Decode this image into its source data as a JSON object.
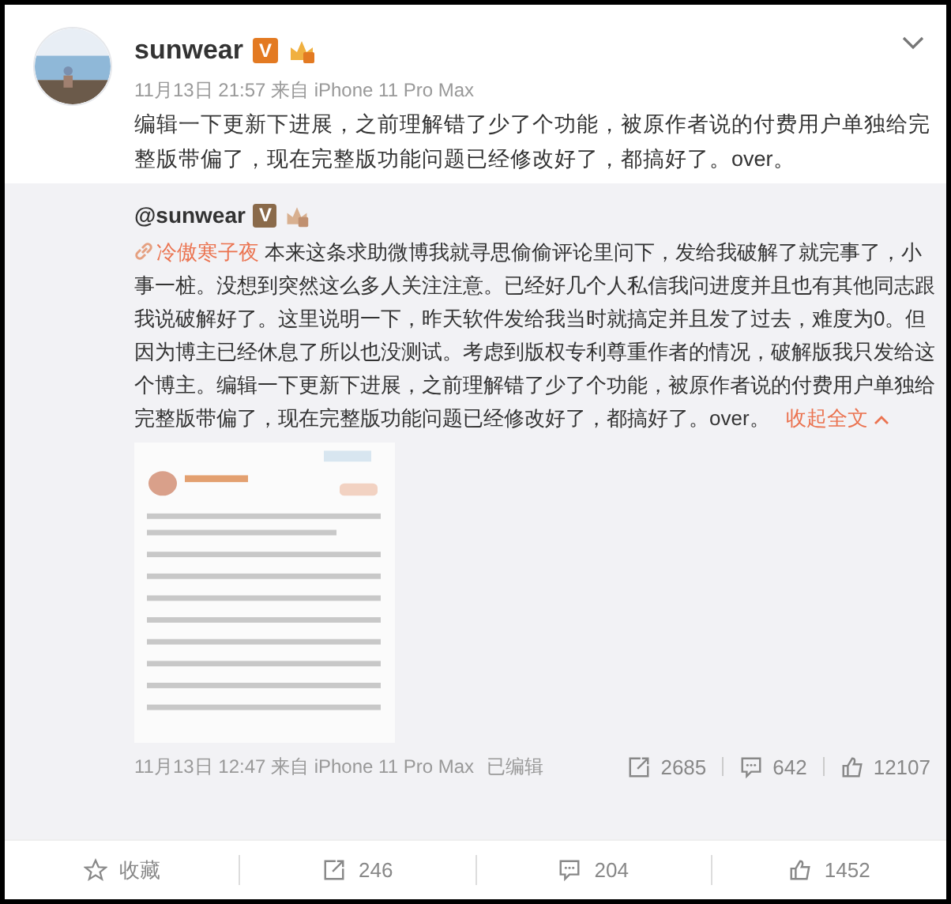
{
  "post": {
    "author": "sunwear",
    "badge": "V",
    "meta": "11月13日 21:57 来自 iPhone 11 Pro Max",
    "text": "编辑一下更新下进展，之前理解错了少了个功能，被原作者说的付费用户单独给完整版带偏了，现在完整版功能问题已经修改好了，都搞好了。over。"
  },
  "repost": {
    "author": "@sunwear",
    "badge": "V",
    "mention": "冷傲寒子夜",
    "text": " 本来这条求助微博我就寻思偷偷评论里问下，发给我破解了就完事了，小事一桩。没想到突然这么多人关注注意。已经好几个人私信我问进度并且也有其他同志跟我说破解好了。这里说明一下，昨天软件发给我当时就搞定并且发了过去，难度为0。但因为博主已经休息了所以也没测试。考虑到版权专利尊重作者的情况，破解版我只发给这个博主。编辑一下更新下进展，之前理解错了少了个功能，被原作者说的付费用户单独给完整版带偏了，现在完整版功能问题已经修改好了，都搞好了。over。",
    "collapse": "收起全文",
    "meta": "11月13日 12:47 来自 iPhone 11 Pro Max",
    "edited": "已编辑",
    "stats": [
      {
        "kind": "share",
        "count": "2685"
      },
      {
        "kind": "comment",
        "count": "642"
      },
      {
        "kind": "like",
        "count": "12107"
      }
    ]
  },
  "actions": [
    {
      "kind": "favorite",
      "label": "收藏"
    },
    {
      "kind": "share",
      "label": "246"
    },
    {
      "kind": "comment",
      "label": "204"
    },
    {
      "kind": "like",
      "label": "1452"
    }
  ]
}
